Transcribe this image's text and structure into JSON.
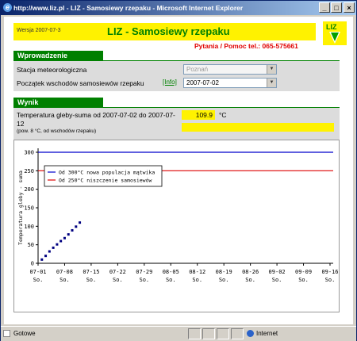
{
  "window": {
    "title": "http://www.liz.pl - LIZ - Samosiewy rzepaku - Microsoft Internet Explorer",
    "buttons": {
      "minimize": "_",
      "maximize": "□",
      "close": "×"
    }
  },
  "page": {
    "version": "Wersja 2007-07-3",
    "title": "LIZ - Samosiewy rzepaku",
    "help": "Pytania / Pomoc tel.: 065-575661",
    "logo_text": "LIZ",
    "accent": "#008000",
    "highlight": "#fff200"
  },
  "intro": {
    "heading": "Wprowadzenie",
    "station_label": "Stacja meteorologiczna",
    "station_value": "Poznań",
    "start_label": "Początek wschodów samosiewów rzepaku",
    "info_link": "[Info]",
    "start_value": "2007-07-02"
  },
  "result": {
    "heading": "Wynik",
    "sum_label_1": "Temperatura gleby-suma od 2007-07-02 do 2007-07-",
    "sum_label_2": "12",
    "sum_note": "(pow. 8 °C, od wschodów rzepaku)",
    "value": "109.9",
    "unit": "°C"
  },
  "chart_data": {
    "type": "line",
    "ylabel": "Temperatura gleby - suma",
    "ylim": [
      0,
      300
    ],
    "yticks": [
      "0",
      "50",
      "100",
      "150",
      "200",
      "250",
      "300"
    ],
    "xticks": [
      {
        "date": "07-01",
        "day": "So."
      },
      {
        "date": "07-08",
        "day": "So."
      },
      {
        "date": "07-15",
        "day": "So."
      },
      {
        "date": "07-22",
        "day": "So."
      },
      {
        "date": "07-29",
        "day": "So."
      },
      {
        "date": "08-05",
        "day": "So."
      },
      {
        "date": "08-12",
        "day": "So."
      },
      {
        "date": "08-19",
        "day": "So."
      },
      {
        "date": "08-26",
        "day": "So."
      },
      {
        "date": "09-02",
        "day": "So."
      },
      {
        "date": "09-09",
        "day": "So."
      },
      {
        "date": "09-16",
        "day": "So."
      }
    ],
    "series": [
      {
        "name": "Od 300°C nowa populacja mątwika",
        "color": "#0000cc",
        "type": "hline",
        "y": 300
      },
      {
        "name": "Od 250°C niszczenie samosiewów",
        "color": "#dd0000",
        "type": "hline",
        "y": 250
      },
      {
        "name": "",
        "color": "#000080",
        "type": "points",
        "x": [
          "07-02",
          "07-03",
          "07-04",
          "07-05",
          "07-06",
          "07-07",
          "07-08",
          "07-09",
          "07-10",
          "07-11",
          "07-12"
        ],
        "y": [
          10,
          20,
          32,
          42,
          51,
          60,
          68,
          78,
          89,
          99,
          110
        ]
      }
    ]
  },
  "statusbar": {
    "status": "Gotowe",
    "zone": "Internet"
  }
}
